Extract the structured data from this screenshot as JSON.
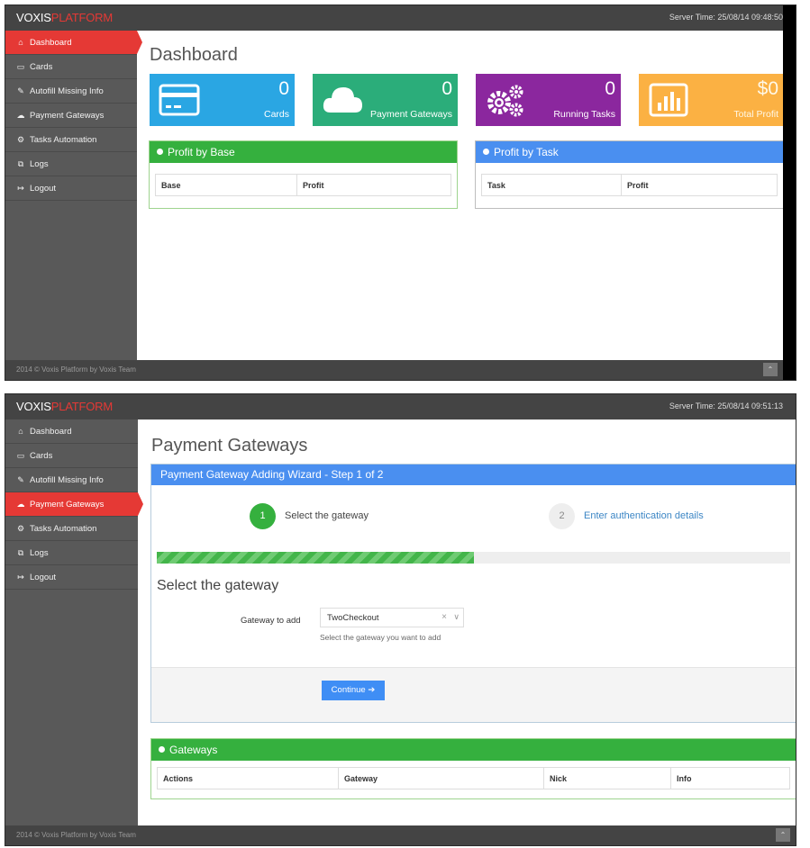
{
  "brand": {
    "part1": "VOXIS",
    "part2": "PLATFORM"
  },
  "nav": [
    {
      "icon": "⌂",
      "label": "Dashboard"
    },
    {
      "icon": "▭",
      "label": "Cards"
    },
    {
      "icon": "✎",
      "label": "Autofill Missing Info"
    },
    {
      "icon": "☁",
      "label": "Payment Gateways"
    },
    {
      "icon": "⚙",
      "label": "Tasks Automation"
    },
    {
      "icon": "⧉",
      "label": "Logs"
    },
    {
      "icon": "↦",
      "label": "Logout"
    }
  ],
  "footer": {
    "text": "2014 © Voxis Platform by Voxis Team",
    "totop": "⌃"
  },
  "dashboard": {
    "server_time": "Server Time: 25/08/14 09:48:50",
    "title": "Dashboard",
    "tiles": {
      "cards": {
        "value": "0",
        "label": "Cards",
        "icon": "credit-card-icon"
      },
      "gateways": {
        "value": "0",
        "label": "Payment Gateways",
        "icon": "cloud-icon"
      },
      "tasks": {
        "value": "0",
        "label": "Running Tasks",
        "icon": "gears-icon"
      },
      "profit": {
        "value": "$0",
        "label": "Total Profit",
        "icon": "bar-chart-icon"
      }
    },
    "profit_by_base": {
      "title": "Profit by Base",
      "columns": [
        "Base",
        "Profit"
      ]
    },
    "profit_by_task": {
      "title": "Profit by Task",
      "columns": [
        "Task",
        "Profit"
      ]
    }
  },
  "gateways_page": {
    "server_time": "Server Time: 25/08/14 09:51:13",
    "title": "Payment Gateways",
    "wizard": {
      "title": "Payment Gateway Adding Wizard - Step 1 of 2",
      "steps": [
        {
          "number": "1",
          "label": "Select the gateway"
        },
        {
          "number": "2",
          "label": "Enter authentication details"
        }
      ],
      "progress_fraction": 0.5,
      "section_title": "Select the gateway",
      "field_label": "Gateway to add",
      "select_value": "TwoCheckout",
      "clear_glyph": "×",
      "caret_glyph": "∨",
      "help": "Select the gateway you want to add",
      "continue_label": "Continue ➔"
    },
    "gateways_panel": {
      "title": "Gateways",
      "columns": [
        "Actions",
        "Gateway",
        "Nick",
        "Info"
      ]
    }
  },
  "colors": {
    "red": "#e53935",
    "blue": "#2aa6e3",
    "teal": "#2bad7a",
    "purple": "#8b279e",
    "orange": "#fbb143",
    "green": "#35b03e",
    "header_blue": "#4a8ff0"
  }
}
